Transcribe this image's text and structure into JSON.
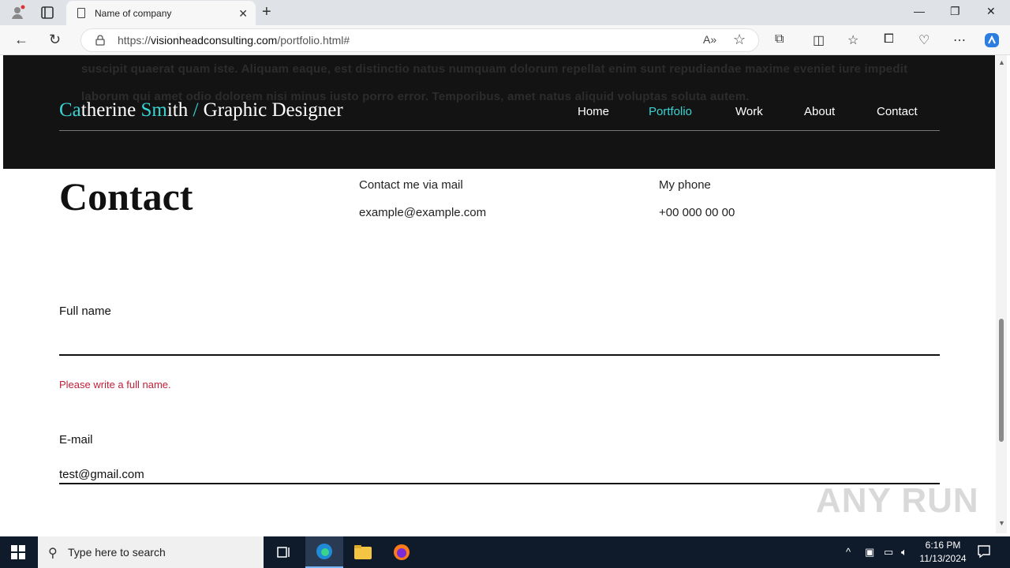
{
  "browser": {
    "tab_title": "Name of company",
    "url_prefix": "https://",
    "url_domain": "visionheadconsulting.com",
    "url_path": "/portfolio.html#"
  },
  "page": {
    "background_text": "suscipit quaerat quam iste. Aliquam eaque, est distinctio natus numquam dolorum repellat enim sunt repudiandae maxime eveniet iure impedit laborum qui amet odio dolorem nisi minus iusto porro error. Temporibus, amet natus aliquid voluptas soluta autem.",
    "logo": {
      "part1_accent": "Ca",
      "part1_rest": "therine ",
      "part2_accent": "Sm",
      "part2_rest": "ith ",
      "slash": "/",
      "rest": " Graphic Designer"
    },
    "nav": [
      "Home",
      "Portfolio",
      "Work",
      "About",
      "Contact"
    ],
    "active_nav": "Portfolio",
    "contact_heading": "Contact",
    "mail_label": "Contact me via mail",
    "mail_value": "example@example.com",
    "phone_label": "My phone",
    "phone_value": "+00 000 00 00",
    "form": {
      "fullname_label": "Full name",
      "fullname_value": "",
      "fullname_error": "Please write a full name.",
      "email_label": "E-mail",
      "email_value": "test@gmail.com"
    },
    "accent_color": "#39d3d3",
    "error_color": "#c0203a"
  },
  "watermark": "ANY RUN",
  "taskbar": {
    "search_placeholder": "Type here to search",
    "time": "6:16 PM",
    "date": "11/13/2024"
  }
}
